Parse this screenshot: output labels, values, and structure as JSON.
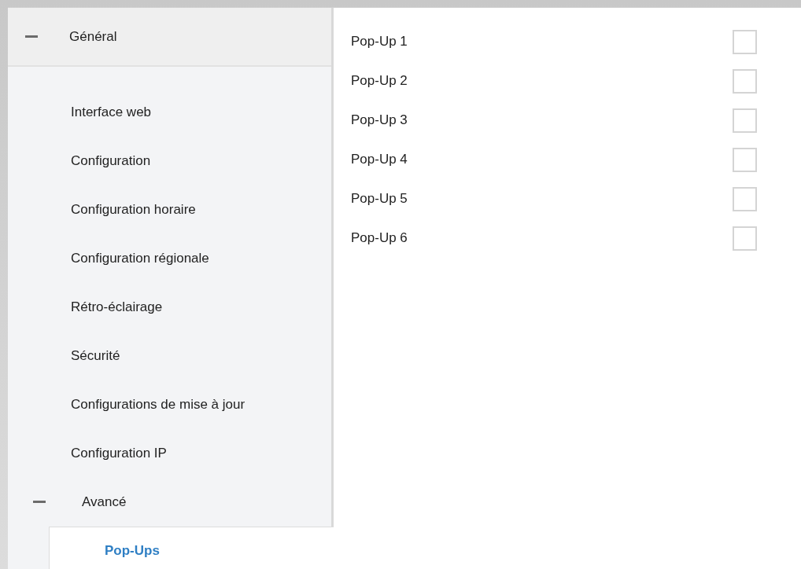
{
  "sidebar": {
    "header": {
      "label": "Général",
      "expanded": true
    },
    "items": [
      {
        "label": "Interface web",
        "selected": false
      },
      {
        "label": "Configuration",
        "selected": false
      },
      {
        "label": "Configuration horaire",
        "selected": false
      },
      {
        "label": "Configuration régionale",
        "selected": false
      },
      {
        "label": "Rétro-éclairage",
        "selected": false
      },
      {
        "label": "Sécurité",
        "selected": false
      },
      {
        "label": "Configurations de mise à jour",
        "selected": false
      },
      {
        "label": "Configuration IP",
        "selected": false
      },
      {
        "label": "Avancé",
        "kind": "group",
        "expanded": true,
        "children": [
          {
            "label": "Pop-Ups",
            "selected": true
          }
        ]
      }
    ]
  },
  "options": [
    {
      "label": "Pop-Up 1",
      "checked": false
    },
    {
      "label": "Pop-Up 2",
      "checked": false
    },
    {
      "label": "Pop-Up 3",
      "checked": false
    },
    {
      "label": "Pop-Up 4",
      "checked": false
    },
    {
      "label": "Pop-Up 5",
      "checked": false
    },
    {
      "label": "Pop-Up 6",
      "checked": false
    }
  ]
}
